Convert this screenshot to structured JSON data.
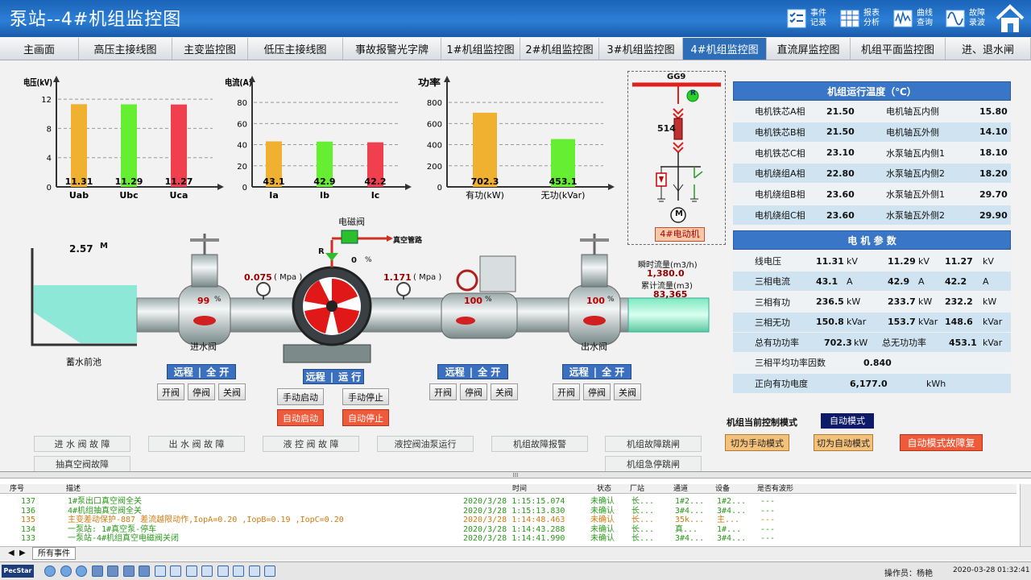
{
  "app": {
    "title": "泵站--4#机组监控图"
  },
  "toolbar": [
    {
      "label1": "事件",
      "label2": "记录",
      "icon": "checklist-icon"
    },
    {
      "label1": "报表",
      "label2": "分析",
      "icon": "table-icon"
    },
    {
      "label1": "曲线",
      "label2": "查询",
      "icon": "waveform-icon"
    },
    {
      "label1": "故障",
      "label2": "录波",
      "icon": "sine-wave-icon"
    }
  ],
  "nav": [
    "主画面",
    "高压主接线图",
    "主变监控图",
    "低压主接线图",
    "事故报警光字牌",
    "1#机组监控图",
    "2#机组监控图",
    "3#机组监控图",
    "4#机组监控图",
    "直流屏监控图",
    "机组平面监控图",
    "进、退水闸"
  ],
  "nav_active": 8,
  "chart_data": [
    {
      "type": "bar",
      "ylabel": "电压(kV)",
      "yticks": [
        0,
        4,
        8,
        12
      ],
      "ylim": [
        0,
        13
      ],
      "categories": [
        "Uab",
        "Ubc",
        "Uca"
      ],
      "values": [
        11.31,
        11.29,
        11.27
      ],
      "labels": [
        "11.31",
        "11.29",
        "11.27"
      ],
      "colors": [
        "#f0b030",
        "#66ee33",
        "#f04050"
      ]
    },
    {
      "type": "bar",
      "ylabel": "电流(A)",
      "yticks": [
        0,
        20,
        40,
        60,
        80
      ],
      "ylim": [
        0,
        90
      ],
      "categories": [
        "Ia",
        "Ib",
        "Ic"
      ],
      "values": [
        43.1,
        42.9,
        42.2
      ],
      "labels": [
        "43.1",
        "42.9",
        "42.2"
      ],
      "colors": [
        "#f0b030",
        "#66ee33",
        "#f04050"
      ]
    },
    {
      "type": "bar",
      "ylabel": "功率",
      "yticks": [
        0,
        200,
        400,
        600,
        800
      ],
      "ylim": [
        0,
        900
      ],
      "categories": [
        "有功(kW)",
        "无功(kVar)"
      ],
      "values": [
        702.3,
        453.1
      ],
      "labels": [
        "702.3",
        "453.1"
      ],
      "colors": [
        "#f0b030",
        "#66ee33"
      ]
    }
  ],
  "diagram": {
    "bus": "GG9",
    "breaker": "514",
    "r_mark": "R",
    "m_mark": "M",
    "motor": "4#电动机",
    "pool_level": "2.57",
    "pool_unit": "M",
    "pool_label": "蓄水前池",
    "inlet_valve": "进水阀",
    "outlet_valve": "出水阀",
    "solenoid": "电磁阀",
    "vacuum_pipe": "真空管路",
    "inlet_pct": "99",
    "pct_sign": "%",
    "mid_pct": "100",
    "outlet_pct": "100",
    "p1": "0.075",
    "p2": "1.171",
    "p_unit": "( Mpa )",
    "sol_pct": "0",
    "sol_r": "R",
    "flow_inst_label": "瞬时流量(m3/h)",
    "flow_inst": "1,380.0",
    "flow_total_label": "累计流量(m3)",
    "flow_total": "83,365"
  },
  "temps": {
    "title": "机组运行温度（℃）",
    "rows": [
      [
        "电机铁芯A相",
        "21.50",
        "电机轴瓦内侧",
        "15.80"
      ],
      [
        "电机铁芯B相",
        "21.50",
        "电机轴瓦外侧",
        "14.10"
      ],
      [
        "电机铁芯C相",
        "23.10",
        "水泵轴瓦内侧1",
        "18.10"
      ],
      [
        "电机绕组A相",
        "22.80",
        "水泵轴瓦内侧2",
        "18.20"
      ],
      [
        "电机绕组B相",
        "23.60",
        "水泵轴瓦外侧1",
        "29.70"
      ],
      [
        "电机绕组C相",
        "23.60",
        "水泵轴瓦外侧2",
        "29.90"
      ]
    ]
  },
  "params": {
    "title": "电 机 参 数",
    "rows": [
      [
        "线电压",
        "11.31",
        "kV",
        "11.29",
        "kV",
        "11.27",
        "kV"
      ],
      [
        "三相电流",
        "43.1",
        "A",
        "42.9",
        "A",
        "42.2",
        "A"
      ],
      [
        "三相有功",
        "236.5",
        "kW",
        "233.7",
        "kW",
        "232.2",
        "kW"
      ],
      [
        "三相无功",
        "150.8",
        "kVar",
        "153.7",
        "kVar",
        "148.6",
        "kVar"
      ]
    ],
    "total_p_label": "总有功功率",
    "total_p": "702.3",
    "total_p_unit": "kW",
    "total_q_label": "总无功功率",
    "total_q": "453.1",
    "total_q_unit": "kVar",
    "pf_label": "三相平均功率因数",
    "pf": "0.840",
    "energy_label": "正向有功电度",
    "energy": "6,177.0",
    "energy_unit": "kWh"
  },
  "controls": {
    "g1": {
      "remote": "远程",
      "state": "全 开",
      "b1": "开阀",
      "b2": "停阀",
      "b3": "关阀"
    },
    "g2": {
      "remote": "远程",
      "state": "运 行",
      "b1": "手动启动",
      "b2": "手动停止",
      "b3": "自动启动",
      "b4": "自动停止"
    },
    "g3": {
      "remote": "远程",
      "state": "全 开",
      "b1": "开阀",
      "b2": "停阀",
      "b3": "关阀"
    },
    "g4": {
      "remote": "远程",
      "state": "全 开",
      "b1": "开阀",
      "b2": "停阀",
      "b3": "关阀"
    },
    "mode_label": "机组当前控制模式",
    "mode_value": "自动模式",
    "to_manual": "切为手动模式",
    "to_auto": "切为自动模式",
    "auto_reset": "自动模式故障复"
  },
  "faults": [
    "进 水 阀 故 障",
    "出 水 阀 故 障",
    "液 控 阀 故 障",
    "液控阀油泵运行",
    "机组故障报警",
    "机组故障跳闸",
    "抽真空阀故障",
    "机组急停跳闸"
  ],
  "events": {
    "headers": [
      "序号",
      "描述",
      "时间",
      "状态",
      "厂站",
      "通道",
      "设备",
      "是否有波形"
    ],
    "rows": [
      {
        "id": "137",
        "desc": "1#泵出口真空阀全关",
        "time": "2020/3/28  1:15:15.074",
        "state": "未确认",
        "station": "长...",
        "ch": "1#2...",
        "dev": "1#2...",
        "wave": "---",
        "color": "#2a9a1a"
      },
      {
        "id": "136",
        "desc": "4#机组抽真空阀全关",
        "time": "2020/3/28  1:15:13.830",
        "state": "未确认",
        "station": "长...",
        "ch": "3#4...",
        "dev": "3#4...",
        "wave": "---",
        "color": "#2a9a1a"
      },
      {
        "id": "135",
        "desc": "主变差动保护-887 差流越限动作,IopA=0.20 ,IopB=0.19 ,IopC=0.20",
        "time": "2020/3/28  1:14:48.463",
        "state": "未确认",
        "station": "长...",
        "ch": "35k...",
        "dev": "主...",
        "wave": "---",
        "color": "#d07a10"
      },
      {
        "id": "134",
        "desc": "一泵站: 1#真空泵-停车",
        "time": "2020/3/28  1:14:43.288",
        "state": "未确认",
        "station": "长...",
        "ch": "真...",
        "dev": "1#...",
        "wave": "---",
        "color": "#2a9a1a"
      },
      {
        "id": "133",
        "desc": "一泵站-4#机组真空电磁阀关闭",
        "time": "2020/3/28  1:14:41.990",
        "state": "未确认",
        "station": "长...",
        "ch": "3#4...",
        "dev": "3#4...",
        "wave": "---",
        "color": "#2a9a1a"
      }
    ],
    "tab": "所有事件"
  },
  "status": {
    "operator": "操作员：杨艳",
    "datetime": "2020-03-28 01:32:41",
    "logo": "PecStar"
  }
}
